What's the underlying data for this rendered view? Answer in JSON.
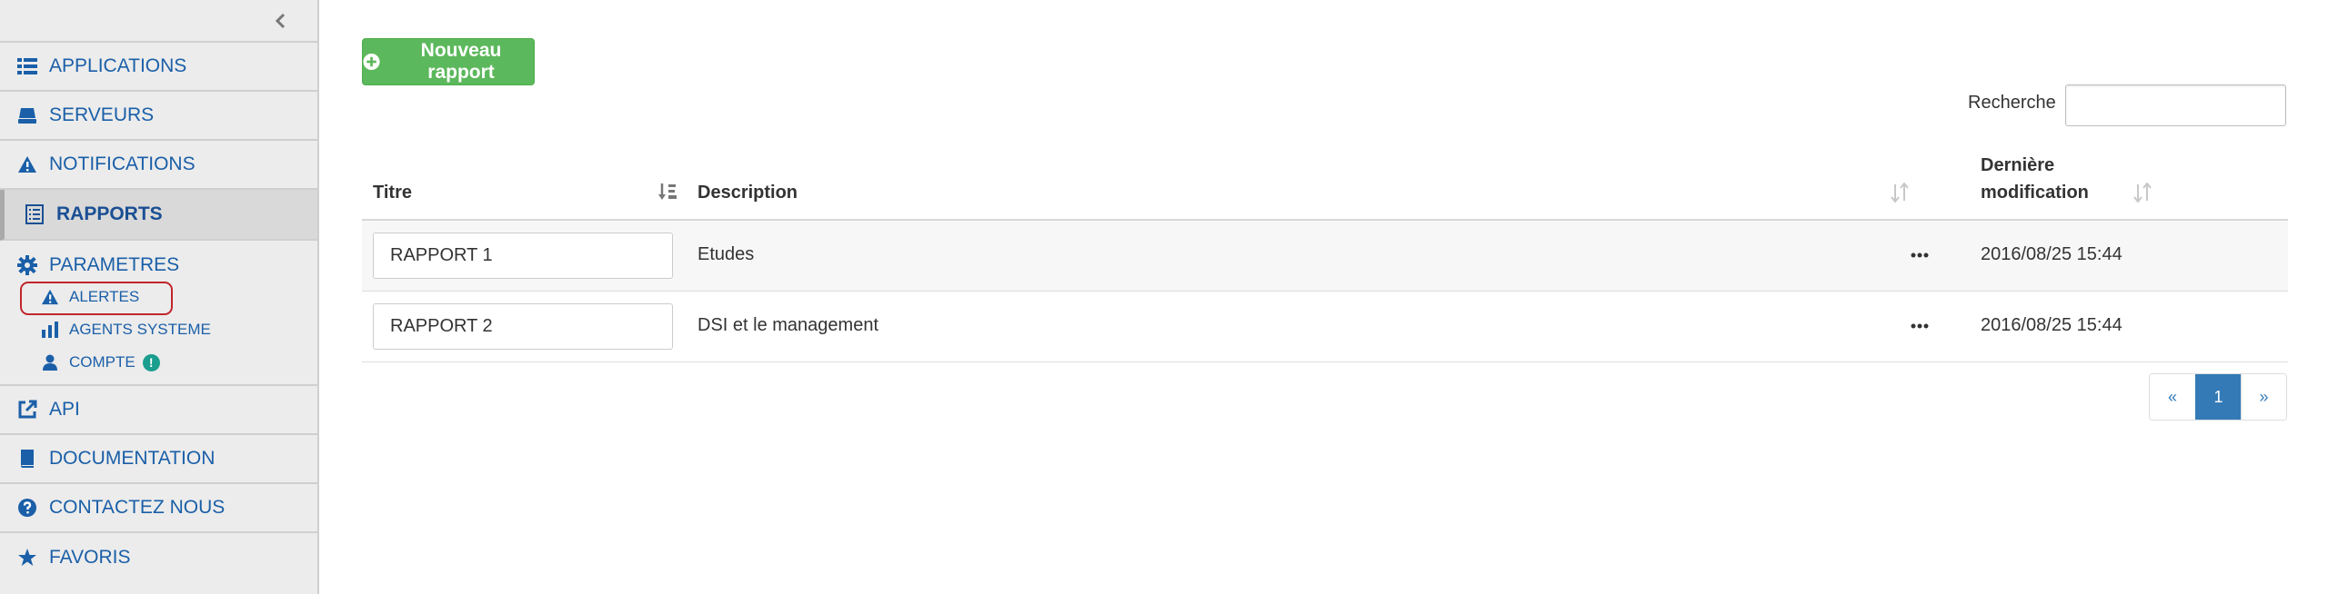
{
  "sidebar": {
    "items": [
      {
        "label": "APPLICATIONS",
        "icon": "list-icon"
      },
      {
        "label": "SERVEURS",
        "icon": "server-icon"
      },
      {
        "label": "NOTIFICATIONS",
        "icon": "warning-icon"
      },
      {
        "label": "RAPPORTS",
        "icon": "report-icon"
      },
      {
        "label": "PARAMETRES",
        "icon": "gear-icon"
      },
      {
        "label": "API",
        "icon": "external-link-icon"
      },
      {
        "label": "DOCUMENTATION",
        "icon": "book-icon"
      },
      {
        "label": "CONTACTEZ NOUS",
        "icon": "question-icon"
      },
      {
        "label": "FAVORIS",
        "icon": "star-icon"
      }
    ],
    "sub_items": [
      {
        "label": "ALERTES",
        "icon": "warning-icon"
      },
      {
        "label": "AGENTS SYSTEME",
        "icon": "bar-chart-icon"
      },
      {
        "label": "COMPTE",
        "icon": "user-icon",
        "badge": "!"
      }
    ],
    "active_item": "RAPPORTS",
    "highlighted_sub_item": "ALERTES"
  },
  "toolbar": {
    "new_report_label": "Nouveau rapport"
  },
  "search": {
    "label": "Recherche",
    "value": ""
  },
  "table": {
    "headers": {
      "title": "Titre",
      "description": "Description",
      "modified_line1": "Dernière",
      "modified_line2": "modification"
    },
    "rows": [
      {
        "title": "RAPPORT 1",
        "description": "Etudes",
        "modified": "2016/08/25 15:44"
      },
      {
        "title": "RAPPORT 2",
        "description": "DSI et le management",
        "modified": "2016/08/25 15:44"
      }
    ]
  },
  "pagination": {
    "prev": "«",
    "current": "1",
    "next": "»"
  },
  "colors": {
    "link": "#1a5fa8",
    "primary": "#337ab7",
    "success": "#5cb85c",
    "alert_outline": "#c0262c",
    "badge": "#1a9e8e"
  }
}
